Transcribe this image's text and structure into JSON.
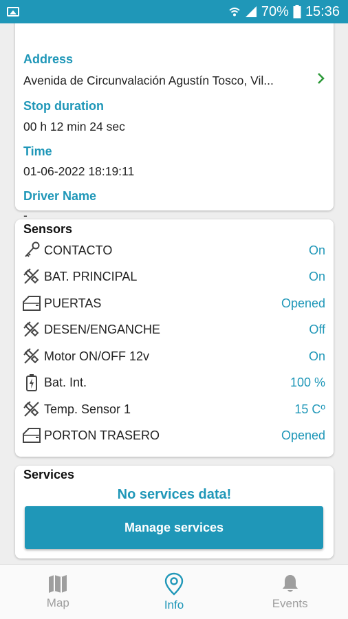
{
  "status_bar": {
    "battery": "70%",
    "time": "15:36"
  },
  "info": {
    "address_label": "Address",
    "address_value": "Avenida de Circunvalación Agustín Tosco, Vil...",
    "stop_duration_label": "Stop duration",
    "stop_duration_value": "00 h 12 min 24 sec",
    "time_label": "Time",
    "time_value": "01-06-2022 18:19:11",
    "driver_label": "Driver Name",
    "driver_value": "-"
  },
  "sensors": {
    "title": "Sensors",
    "items": [
      {
        "name": "CONTACTO",
        "value": "On",
        "icon": "key-icon"
      },
      {
        "name": "BAT. PRINCIPAL",
        "value": "On",
        "icon": "plug-icon"
      },
      {
        "name": "PUERTAS",
        "value": "Opened",
        "icon": "door-icon"
      },
      {
        "name": "DESEN/ENGANCHE",
        "value": "Off",
        "icon": "plug-icon"
      },
      {
        "name": "Motor ON/OFF 12v",
        "value": "On",
        "icon": "plug-icon"
      },
      {
        "name": "Bat. Int.",
        "value": "100 %",
        "icon": "battery-icon"
      },
      {
        "name": "Temp. Sensor 1",
        "value": "15 Cº",
        "icon": "plug-icon"
      },
      {
        "name": "PORTON TRASERO",
        "value": "Opened",
        "icon": "door-icon"
      }
    ]
  },
  "services": {
    "title": "Services",
    "empty_text": "No services data!",
    "manage_label": "Manage services"
  },
  "nav": {
    "map": "Map",
    "info": "Info",
    "events": "Events"
  },
  "colors": {
    "accent": "#1f97b8",
    "chevron": "#2e9a3a",
    "inactive": "#9e9e9e"
  }
}
